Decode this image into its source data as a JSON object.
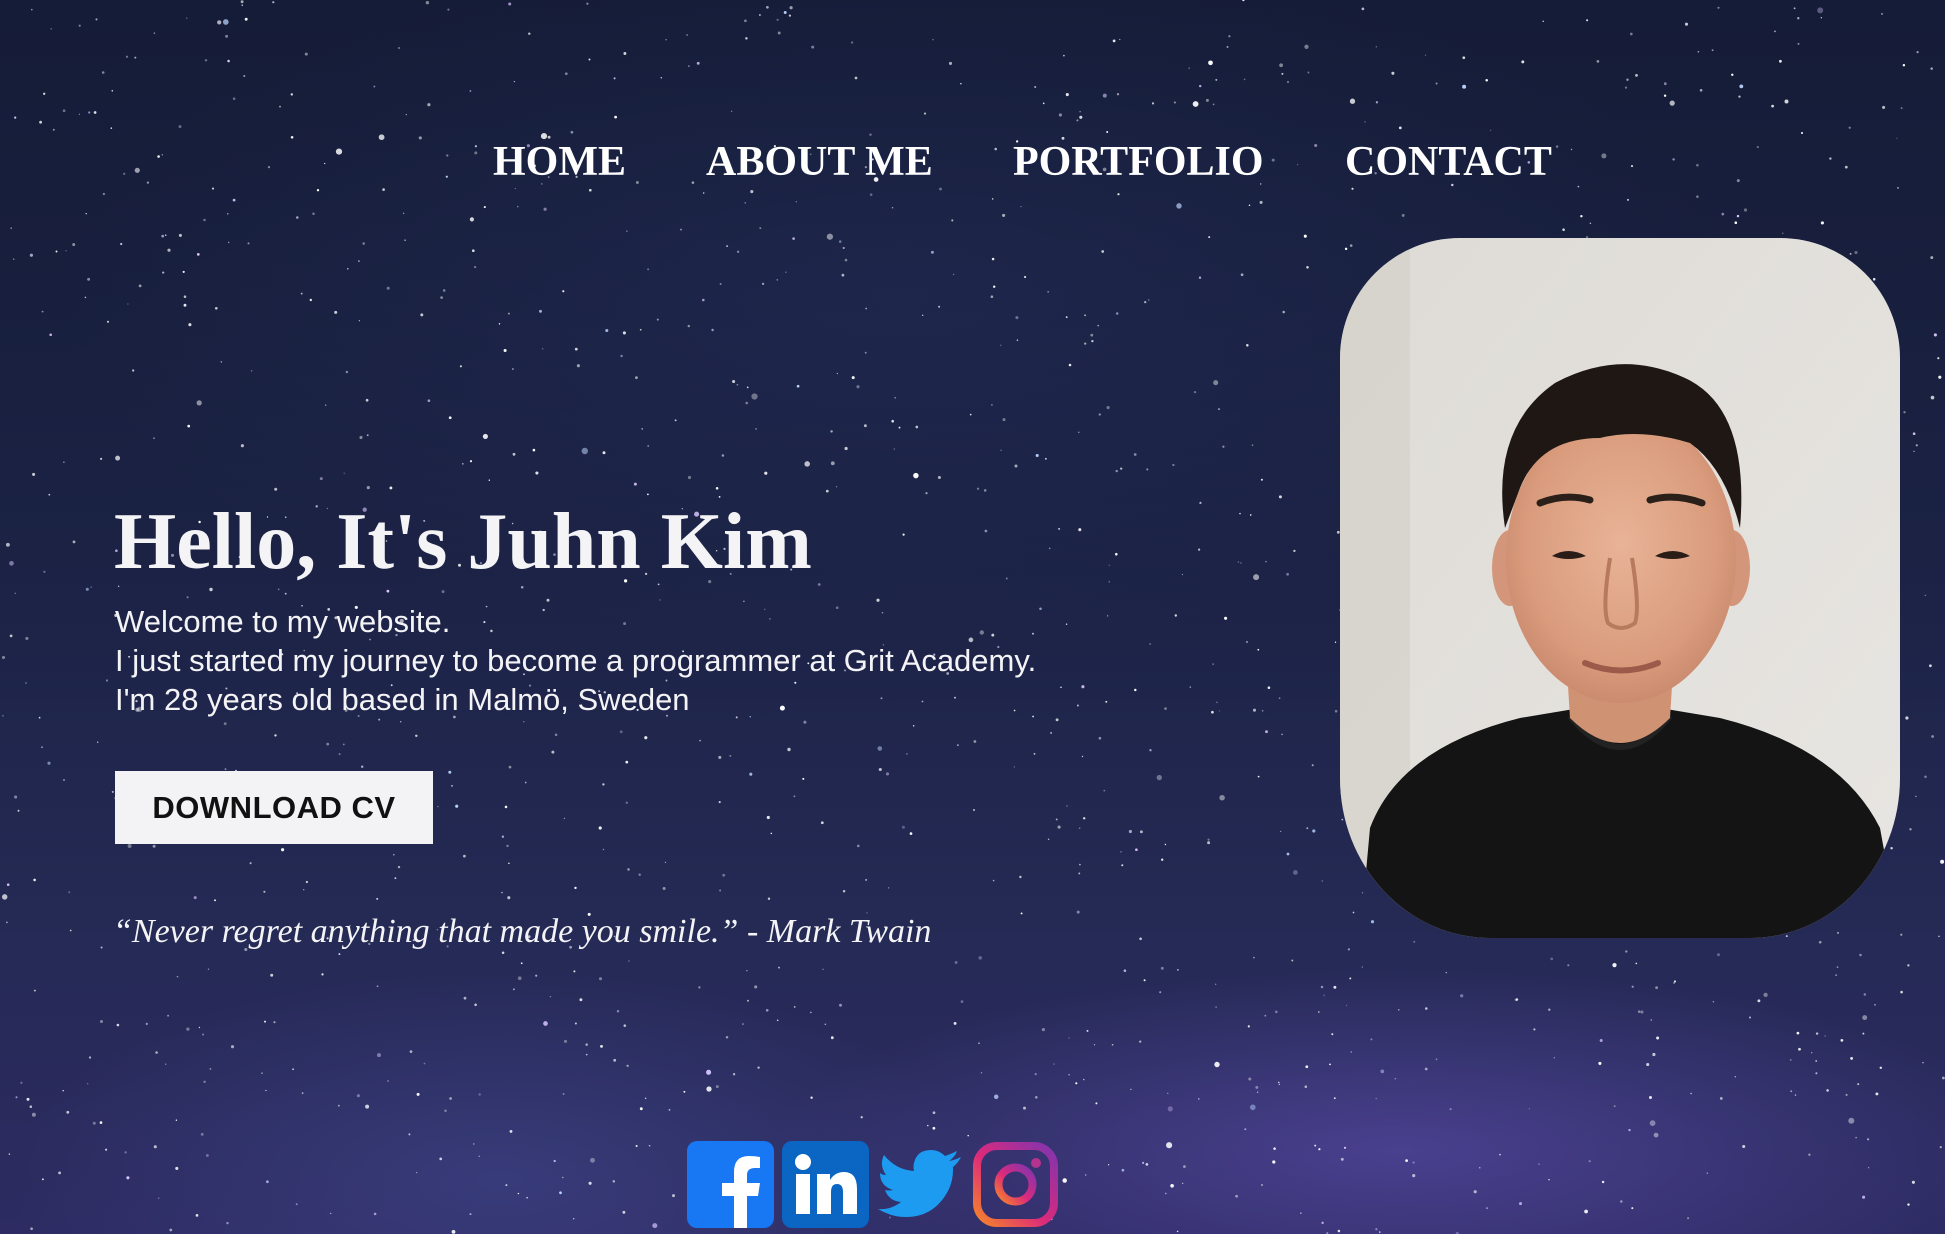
{
  "nav": {
    "items": [
      {
        "label": "HOME"
      },
      {
        "label": "ABOUT ME"
      },
      {
        "label": "PORTFOLIO"
      },
      {
        "label": "CONTACT"
      }
    ]
  },
  "hero": {
    "headline": "Hello, It's Juhn Kim",
    "intro_lines": [
      "Welcome to my website.",
      "I just started my journey to become a programmer at Grit Academy.",
      "I'm 28 years old based in Malmö, Sweden"
    ],
    "download_label": "DOWNLOAD CV",
    "quote": "“Never regret anything that made you smile.” - Mark Twain"
  },
  "portrait": {
    "icon": "person-photo"
  },
  "socials": [
    {
      "icon": "facebook-icon",
      "color": "#1877f2"
    },
    {
      "icon": "linkedin-icon",
      "color": "#0a66c2"
    },
    {
      "icon": "twitter-icon",
      "color": "#1d9bf0"
    },
    {
      "icon": "instagram-icon",
      "color": "#c13584"
    }
  ],
  "colors": {
    "background": "#1b2244",
    "text": "#ffffff",
    "button_bg": "#f3f3f5",
    "button_text": "#111111"
  }
}
